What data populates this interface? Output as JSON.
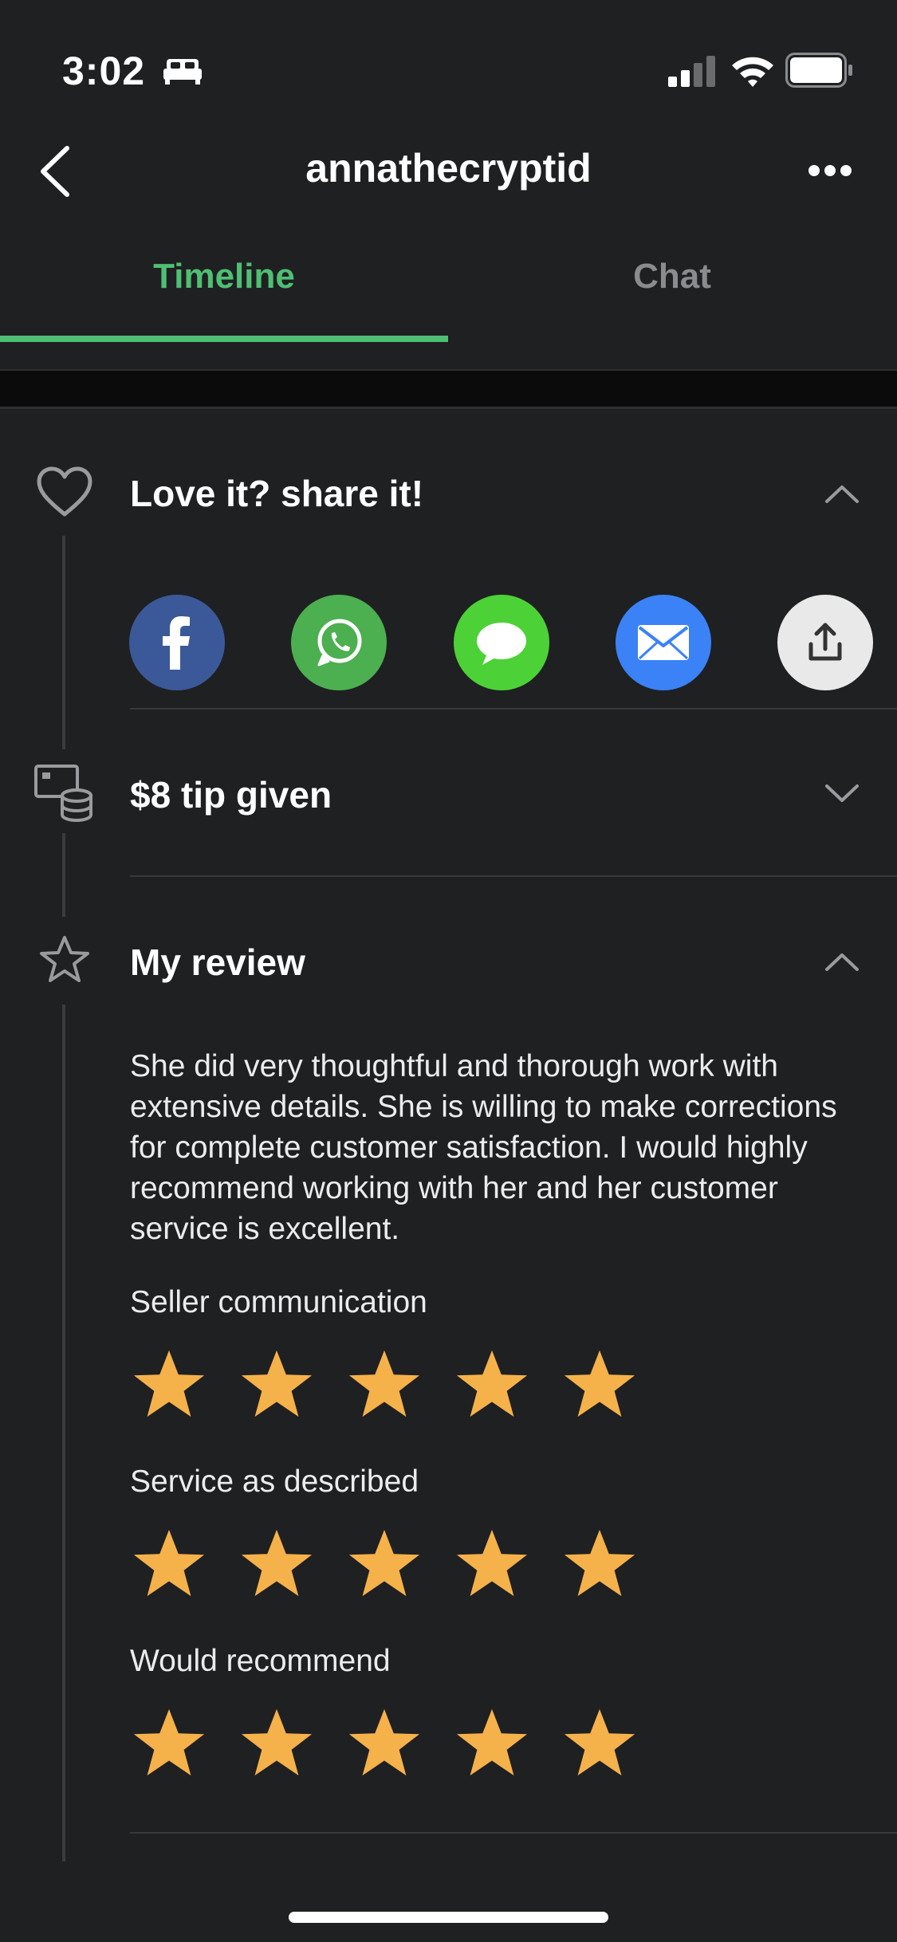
{
  "status_bar": {
    "time": "3:02",
    "sleep_icon": "bed-icon",
    "cellular_icon": "cellular-signal-icon",
    "wifi_icon": "wifi-icon",
    "battery_icon": "battery-icon"
  },
  "header": {
    "title": "annathecryptid",
    "back_icon": "chevron-left-icon",
    "more_icon": "more-horizontal-icon"
  },
  "tabs": [
    {
      "label": "Timeline",
      "active": true
    },
    {
      "label": "Chat",
      "active": false
    }
  ],
  "colors": {
    "accent": "#4fbf73",
    "background": "#1f2022",
    "star": "#f5b24a",
    "facebook": "#3b5998",
    "whatsapp": "#4caf50",
    "messages": "#4cd137",
    "email": "#3b82f6",
    "share": "#e9e9e9"
  },
  "share_section": {
    "title": "Love it? share it!",
    "icon": "heart-icon",
    "toggle_icon": "chevron-up-icon",
    "buttons": [
      "facebook-icon",
      "whatsapp-icon",
      "messages-icon",
      "email-icon",
      "share-icon"
    ]
  },
  "tip_section": {
    "title": "$8 tip given",
    "icon": "tip-coins-icon",
    "toggle_icon": "chevron-down-icon"
  },
  "review_section": {
    "title": "My review",
    "icon": "star-outline-icon",
    "toggle_icon": "chevron-up-icon",
    "text": "She did very thoughtful and thorough work with extensive details. She is willing to make corrections for complete customer satisfaction. I would highly recommend working with her and her customer service is excellent.",
    "ratings": [
      {
        "label": "Seller communication",
        "stars": 5
      },
      {
        "label": "Service as described",
        "stars": 5
      },
      {
        "label": "Would recommend",
        "stars": 5
      }
    ]
  }
}
